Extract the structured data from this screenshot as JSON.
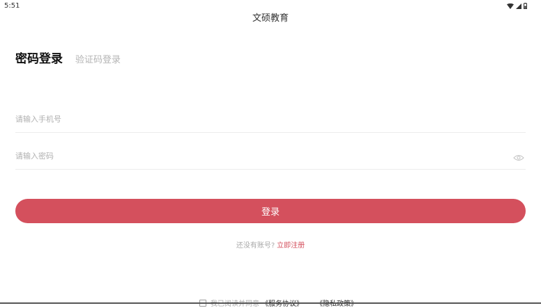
{
  "status_bar": {
    "time": "5:51",
    "icons": [
      "wifi-icon",
      "cell-signal-icon",
      "battery-icon"
    ]
  },
  "app": {
    "title": "文硕教育"
  },
  "tabs": {
    "password_login": "密码登录",
    "code_login": "验证码登录"
  },
  "form": {
    "phone_placeholder": "请输入手机号",
    "password_placeholder": "请输入密码",
    "login_label": "登录"
  },
  "register": {
    "prompt": "还没有账号?",
    "link": "立即注册"
  },
  "agreement": {
    "text": "我已阅读并同意",
    "service_link": "《服务协议》",
    "privacy_link": "《隐私政策》"
  },
  "colors": {
    "accent": "#d4505d",
    "placeholder": "#b0b0b0",
    "divider": "#ececec"
  }
}
